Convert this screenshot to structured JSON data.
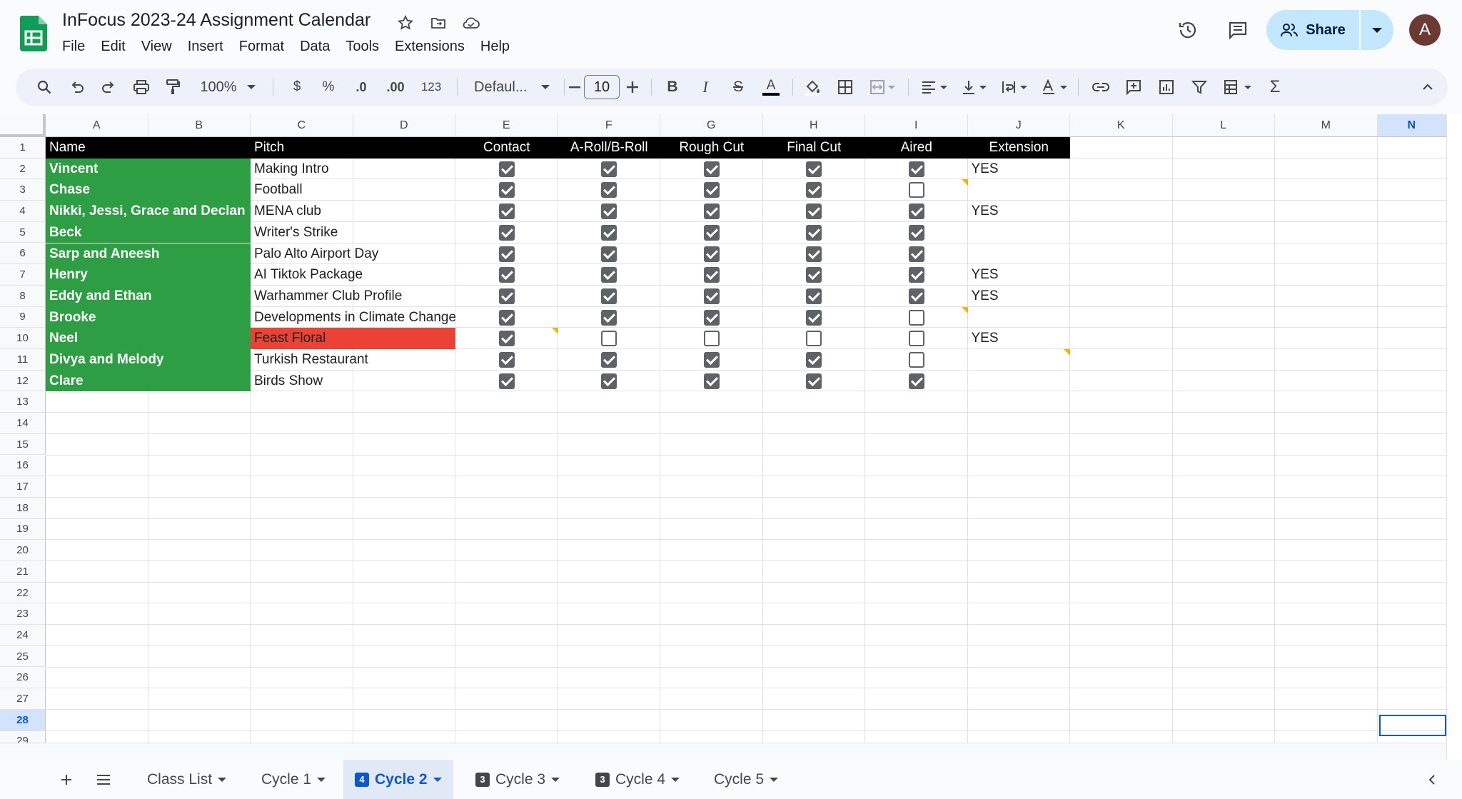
{
  "app": {
    "title": "InFocus 2023-24 Assignment Calendar"
  },
  "menu": [
    "File",
    "Edit",
    "View",
    "Insert",
    "Format",
    "Data",
    "Tools",
    "Extensions",
    "Help"
  ],
  "header": {
    "share_label": "Share",
    "avatar_letter": "A"
  },
  "toolbar": {
    "zoom": "100%",
    "currency": "$",
    "percent": "%",
    "dec_decrease": ".0",
    "dec_increase": ".00",
    "number_format": "123",
    "font": "Defaul...",
    "font_size": "10"
  },
  "columns": [
    "A",
    "B",
    "C",
    "D",
    "E",
    "F",
    "G",
    "H",
    "I",
    "J",
    "K",
    "L",
    "M",
    "N"
  ],
  "selected_column": "N",
  "row_numbers": [
    "1",
    "2",
    "3",
    "4",
    "5",
    "6",
    "7",
    "8",
    "9",
    "10",
    "11",
    "12",
    "13",
    "14",
    "15",
    "16",
    "17",
    "18",
    "19",
    "20",
    "21",
    "22",
    "23",
    "24",
    "25",
    "26",
    "27",
    "28",
    "29"
  ],
  "selected_row": "28",
  "table": {
    "headers": {
      "name": "Name",
      "pitch": "Pitch",
      "contact": "Contact",
      "aroll": "A-Roll/B-Roll",
      "rough": "Rough Cut",
      "final": "Final Cut",
      "aired": "Aired",
      "extension": "Extension"
    },
    "rows": [
      {
        "name": "Vincent",
        "pitch": "Making Intro",
        "checks": [
          true,
          true,
          true,
          true,
          true
        ],
        "extension": "YES"
      },
      {
        "name": "Chase",
        "pitch": "Football",
        "checks": [
          true,
          true,
          true,
          true,
          false
        ],
        "extension": ""
      },
      {
        "name": "Nikki, Jessi, Grace and Declan",
        "pitch": "MENA club",
        "checks": [
          true,
          true,
          true,
          true,
          true
        ],
        "extension": "YES"
      },
      {
        "name": "Beck",
        "pitch": "Writer's Strike",
        "checks": [
          true,
          true,
          true,
          true,
          true
        ],
        "extension": ""
      },
      {
        "name": "Sarp and Aneesh",
        "pitch": "Palo Alto Airport Day",
        "checks": [
          true,
          true,
          true,
          true,
          true
        ],
        "extension": ""
      },
      {
        "name": "Henry",
        "pitch": "AI Tiktok Package",
        "checks": [
          true,
          true,
          true,
          true,
          true
        ],
        "extension": "YES"
      },
      {
        "name": "Eddy and Ethan",
        "pitch": "Warhammer Club Profile",
        "checks": [
          true,
          true,
          true,
          true,
          true
        ],
        "extension": "YES"
      },
      {
        "name": "Brooke",
        "pitch": "Developments in Climate Change",
        "checks": [
          true,
          true,
          true,
          true,
          false
        ],
        "extension": ""
      },
      {
        "name": "Neel",
        "pitch": "Feast Floral",
        "checks": [
          true,
          false,
          false,
          false,
          false
        ],
        "extension": "YES"
      },
      {
        "name": "Divya and Melody",
        "pitch": "Turkish Restaurant",
        "checks": [
          true,
          true,
          true,
          true,
          false
        ],
        "extension": ""
      },
      {
        "name": "Clare",
        "pitch": "Birds Show",
        "checks": [
          true,
          true,
          true,
          true,
          true
        ],
        "extension": ""
      }
    ]
  },
  "colors": {
    "header_bg": "#000000",
    "name_bg": "#2e9e44",
    "highlight_bg": "#ea4335",
    "accent": "#0b57d0",
    "note": "#f4b400"
  },
  "sheets": [
    {
      "label": "Class List",
      "badge": ""
    },
    {
      "label": "Cycle 1",
      "badge": ""
    },
    {
      "label": "Cycle 2",
      "badge": "4"
    },
    {
      "label": "Cycle 3",
      "badge": "3"
    },
    {
      "label": "Cycle 4",
      "badge": "3"
    },
    {
      "label": "Cycle 5",
      "badge": ""
    }
  ],
  "active_sheet": "Cycle 2"
}
